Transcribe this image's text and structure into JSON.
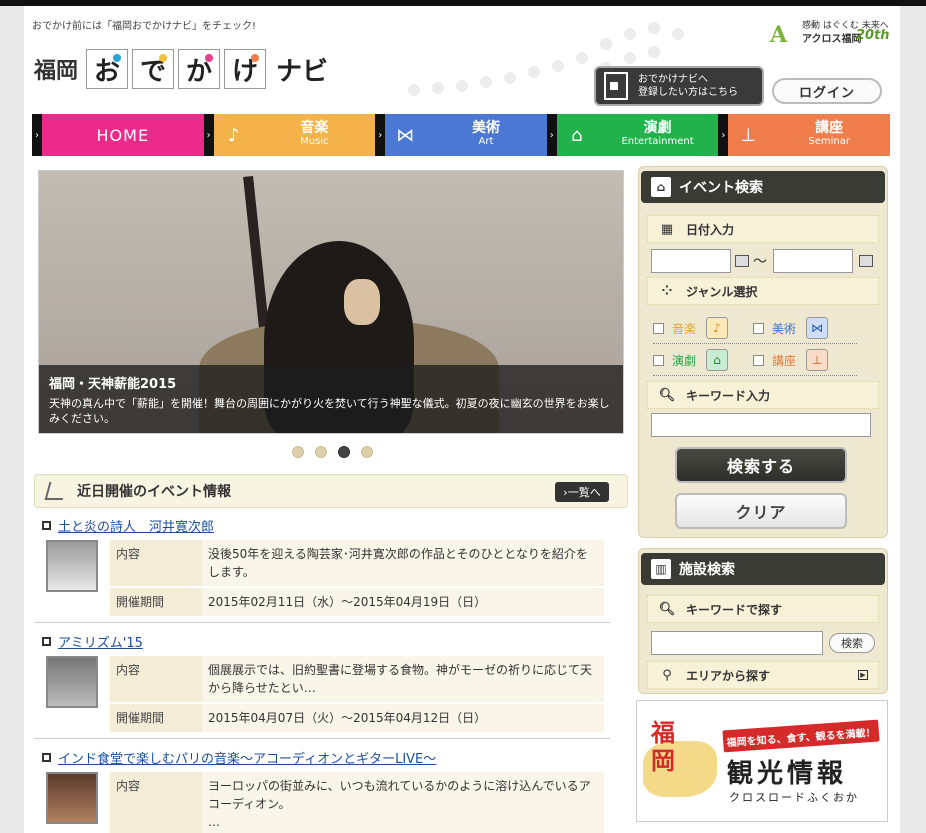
{
  "header": {
    "tagline": "おでかけ前には「福岡おでかけナビ」をチェック!",
    "logo_prefix": "福岡",
    "logo_tiles": [
      "お",
      "で",
      "か",
      "け"
    ],
    "logo_suffix": "ナビ",
    "partner_line1": "感動 はぐくむ 未来へ",
    "partner_line2": "アクロス福岡",
    "partner_anniv": "20th",
    "register_line1": "おでかけナビへ",
    "register_line2": "登録したい方はこちら",
    "login_label": "ログイン"
  },
  "nav": {
    "home": "HOME",
    "items": [
      {
        "jp": "音楽",
        "en": "Music",
        "color": "#f4b24b",
        "icon": "♪"
      },
      {
        "jp": "美術",
        "en": "Art",
        "color": "#4a78d4",
        "icon": "⋈"
      },
      {
        "jp": "演劇",
        "en": "Entertainment",
        "color": "#22b24c",
        "icon": "⌂"
      },
      {
        "jp": "講座",
        "en": "Seminar",
        "color": "#f07e4c",
        "icon": "⊥"
      }
    ]
  },
  "slider": {
    "title": "福岡・天神薪能2015",
    "description": "天神の真ん中で「薪能」を開催！舞台の周囲にかがり火を焚いて行う神聖な儀式。初夏の夜に幽玄の世界をお楽しみください。",
    "pages": 4,
    "active_page": 3
  },
  "events": {
    "heading": "近日開催のイベント情報",
    "more_label": "›一覧へ",
    "key_content": "内容",
    "key_period": "開催期間",
    "items": [
      {
        "title": "土と炎の詩人　河井寛次郎",
        "content": "没後50年を迎える陶芸家･河井寛次郎の作品とそのひととなりを紹介をします。",
        "period": "2015年02月11日（水）～2015年04月19日（日）"
      },
      {
        "title": "アミリズム'15",
        "content": "個展展示では、旧約聖書に登場する食物。神がモーゼの祈りに応じて天から降らせたとい…",
        "period": "2015年04月07日（火）～2015年04月12日（日）"
      },
      {
        "title": "インド食堂で楽しむパリの音楽～アコーディオンとギターLIVE～",
        "content": "ヨーロッパの街並みに、いつも流れているかのように溶け込んでいるアコーディオン。",
        "content_more": "…"
      }
    ]
  },
  "event_search": {
    "title": "イベント検索",
    "date_label": "日付入力",
    "date_from_value": "",
    "date_to_value": "",
    "tilde": "～",
    "genre_label": "ジャンル選択",
    "genres": [
      {
        "label": "音楽",
        "color": "#e5a43a",
        "icon": "♪"
      },
      {
        "label": "美術",
        "color": "#3f6fcc",
        "icon": "⋈"
      },
      {
        "label": "演劇",
        "color": "#22a64a",
        "icon": "⌂"
      },
      {
        "label": "講座",
        "color": "#e0783c",
        "icon": "⊥"
      }
    ],
    "keyword_label": "キーワード入力",
    "keyword_value": "",
    "search_label": "検索する",
    "clear_label": "クリア"
  },
  "facility_search": {
    "title": "施設検索",
    "keyword_label": "キーワードで探す",
    "keyword_value": "",
    "search_label": "検索",
    "area_label": "エリアから探す"
  },
  "banner": {
    "mark": "福\n岡",
    "ribbon": "福岡を知る、食す、観るを満載！",
    "big": "観光情報",
    "small": "クロスロードふくおか"
  }
}
